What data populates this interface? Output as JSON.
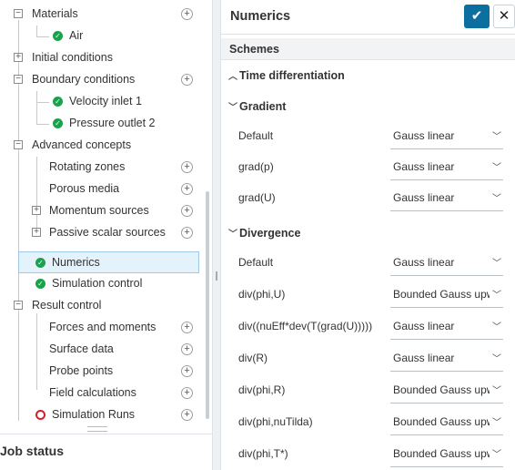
{
  "tree": {
    "materials": "Materials",
    "air": "Air",
    "initial_conditions": "Initial conditions",
    "boundary_conditions": "Boundary conditions",
    "velocity_inlet": "Velocity inlet 1",
    "pressure_outlet": "Pressure outlet 2",
    "advanced_concepts": "Advanced concepts",
    "rotating_zones": "Rotating zones",
    "porous_media": "Porous media",
    "momentum_sources": "Momentum sources",
    "passive_scalar_sources": "Passive scalar sources",
    "numerics": "Numerics",
    "simulation_control": "Simulation control",
    "result_control": "Result control",
    "forces_and_moments": "Forces and moments",
    "surface_data": "Surface data",
    "probe_points": "Probe points",
    "field_calculations": "Field calculations",
    "simulation_runs": "Simulation Runs",
    "plus_glyph": "+",
    "minus_glyph": "−"
  },
  "job_status": {
    "title": "Job status"
  },
  "panel": {
    "title": "Numerics",
    "confirm_icon": "check-icon",
    "close_icon": "close-icon",
    "confirm_glyph": "✔",
    "close_glyph": "✕",
    "schemes_label": "Schemes",
    "time_differentiation": "Time differentiation",
    "gradient": "Gradient",
    "divergence": "Divergence",
    "gradient_rows": [
      {
        "label": "Default",
        "value": "Gauss linear"
      },
      {
        "label": "grad(p)",
        "value": "Gauss linear"
      },
      {
        "label": "grad(U)",
        "value": "Gauss linear"
      }
    ],
    "divergence_rows": [
      {
        "label": "Default",
        "value": "Gauss linear"
      },
      {
        "label": "div(phi,U)",
        "value": "Bounded Gauss upwind"
      },
      {
        "label": "div((nuEff*dev(T(grad(U)))))",
        "value": "Gauss linear"
      },
      {
        "label": "div(R)",
        "value": "Gauss linear"
      },
      {
        "label": "div(phi,R)",
        "value": "Bounded Gauss upwind"
      },
      {
        "label": "div(phi,nuTilda)",
        "value": "Bounded Gauss upwind"
      },
      {
        "label": "div(phi,T*)",
        "value": "Bounded Gauss upwind"
      }
    ]
  },
  "colors": {
    "accent": "#0d6ea0",
    "success": "#18a34a",
    "error": "#d0202f",
    "selected_bg": "#e3f2fb"
  }
}
